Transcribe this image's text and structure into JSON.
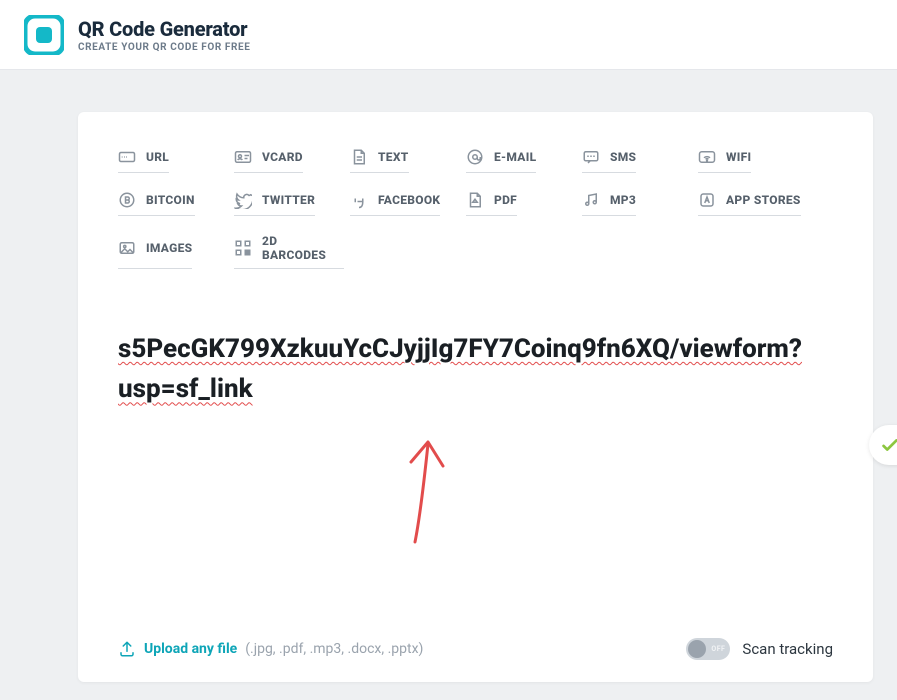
{
  "header": {
    "title": "QR Code Generator",
    "subtitle": "CREATE YOUR QR CODE FOR FREE"
  },
  "types": [
    {
      "id": "url",
      "label": "URL"
    },
    {
      "id": "vcard",
      "label": "VCARD"
    },
    {
      "id": "text",
      "label": "TEXT"
    },
    {
      "id": "email",
      "label": "E-MAIL"
    },
    {
      "id": "sms",
      "label": "SMS"
    },
    {
      "id": "wifi",
      "label": "WIFI"
    },
    {
      "id": "bitcoin",
      "label": "BITCOIN"
    },
    {
      "id": "twitter",
      "label": "TWITTER"
    },
    {
      "id": "facebook",
      "label": "FACEBOOK"
    },
    {
      "id": "pdf",
      "label": "PDF"
    },
    {
      "id": "mp3",
      "label": "MP3"
    },
    {
      "id": "appstores",
      "label": "APP STORES"
    },
    {
      "id": "images",
      "label": "IMAGES"
    },
    {
      "id": "barcodes",
      "label": "2D BARCODES"
    }
  ],
  "input": {
    "value_line1": "s5PecGK799XzkuuYcCJyjjIg7FY7Coinq9fn6XQ/viewform?",
    "value_line2": "usp=sf_link"
  },
  "footer": {
    "upload_label": "Upload any file",
    "upload_hint": "(.jpg, .pdf, .mp3, .docx, .pptx)",
    "scan_label": "Scan tracking",
    "toggle_state": "OFF"
  },
  "colors": {
    "accent": "#14b8c8",
    "annotation": "#e24c4c"
  }
}
